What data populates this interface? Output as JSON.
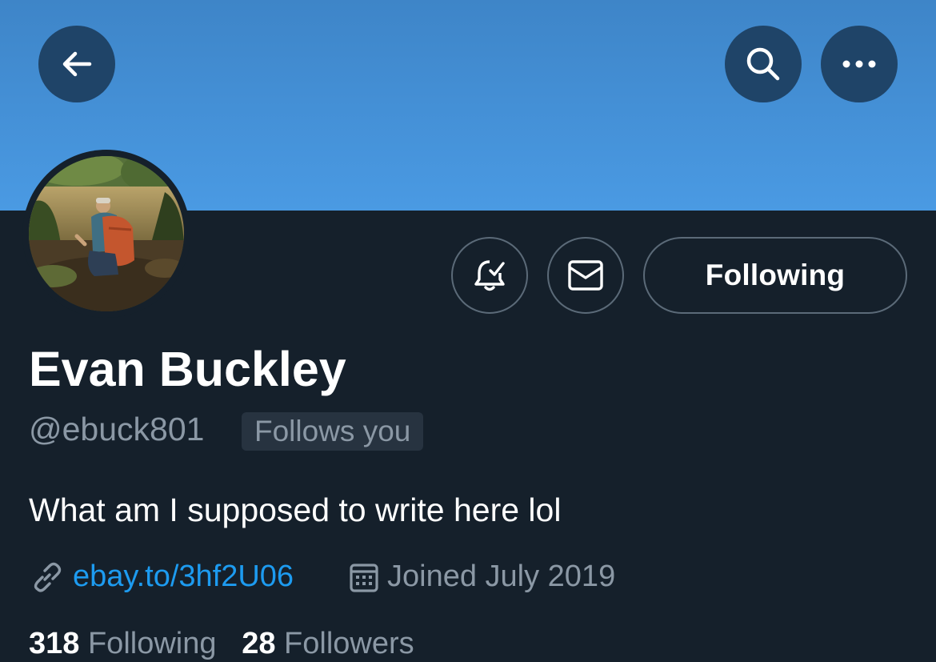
{
  "profile": {
    "name": "Evan Buckley",
    "handle": "@ebuck801",
    "follows_you": "Follows you",
    "bio": "What am I supposed to write here lol",
    "link": "ebay.to/3hf2U06",
    "joined": "Joined July 2019"
  },
  "actions": {
    "following_label": "Following"
  },
  "stats": {
    "following_count": "318",
    "following_label": "Following",
    "followers_count": "28",
    "followers_label": "Followers"
  },
  "icons": {
    "back": "arrow-left-icon",
    "search": "search-icon",
    "more": "more-dots-icon",
    "notify": "bell-check-icon",
    "message": "envelope-icon",
    "link": "link-icon",
    "calendar": "calendar-icon"
  },
  "colors": {
    "background": "#15202b",
    "banner": "#4a9ae3",
    "accent_link": "#1d9bf0",
    "secondary_text": "#8b98a5"
  }
}
